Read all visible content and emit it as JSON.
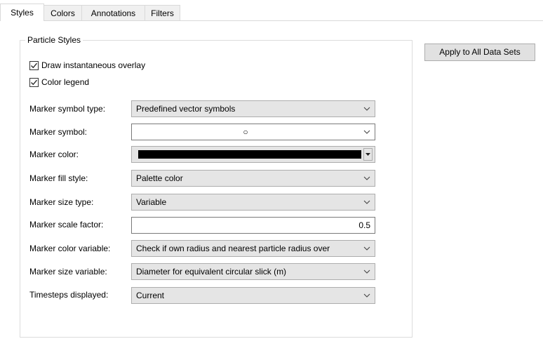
{
  "tabs": [
    {
      "label": "Styles",
      "active": true
    },
    {
      "label": "Colors",
      "active": false
    },
    {
      "label": "Annotations",
      "active": false
    },
    {
      "label": "Filters",
      "active": false
    }
  ],
  "group": {
    "title": "Particle Styles",
    "checkboxes": [
      {
        "label": "Draw instantaneous overlay",
        "checked": true
      },
      {
        "label": "Color legend",
        "checked": true
      }
    ],
    "fields": {
      "marker_symbol_type": {
        "label": "Marker symbol type:",
        "value": "Predefined vector symbols"
      },
      "marker_symbol": {
        "label": "Marker symbol:",
        "value": "○"
      },
      "marker_color": {
        "label": "Marker color:",
        "value": "#000000"
      },
      "marker_fill_style": {
        "label": "Marker fill style:",
        "value": "Palette color"
      },
      "marker_size_type": {
        "label": "Marker size type:",
        "value": "Variable"
      },
      "marker_scale_factor": {
        "label": "Marker scale factor:",
        "value": "0.5"
      },
      "marker_color_variable": {
        "label": "Marker color variable:",
        "value": "Check if own radius and nearest particle radius over"
      },
      "marker_size_variable": {
        "label": "Marker size variable:",
        "value": "Diameter for equivalent circular slick (m)"
      },
      "timesteps_displayed": {
        "label": "Timesteps displayed:",
        "value": "Current"
      }
    }
  },
  "buttons": {
    "apply_all": "Apply to All Data Sets"
  },
  "icons": {
    "checkmark": "checkmark-icon",
    "dropdown": "chevron-down-icon",
    "dropdown_small": "triangle-down-icon"
  }
}
